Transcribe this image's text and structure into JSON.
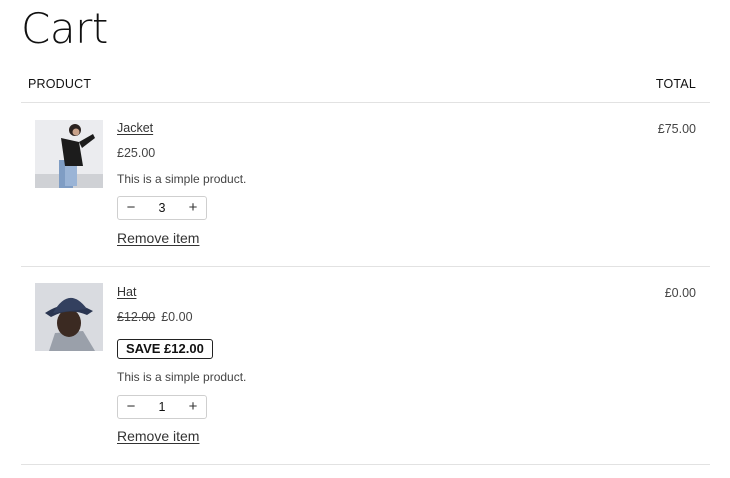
{
  "page": {
    "title": "Cart"
  },
  "table": {
    "product_header": "PRODUCT",
    "total_header": "TOTAL"
  },
  "items": [
    {
      "name": "Jacket",
      "price": "£25.00",
      "description": "This is a simple product.",
      "quantity": "3",
      "remove_label": "Remove item",
      "total": "£75.00",
      "image_icon": "jacket-product-photo"
    },
    {
      "name": "Hat",
      "original_price": "£12.00",
      "price": "£0.00",
      "save_badge": "SAVE £12.00",
      "description": "This is a simple product.",
      "quantity": "1",
      "remove_label": "Remove item",
      "total": "£0.00",
      "image_icon": "hat-product-photo"
    }
  ],
  "controls": {
    "minus": "−",
    "plus": "+"
  }
}
